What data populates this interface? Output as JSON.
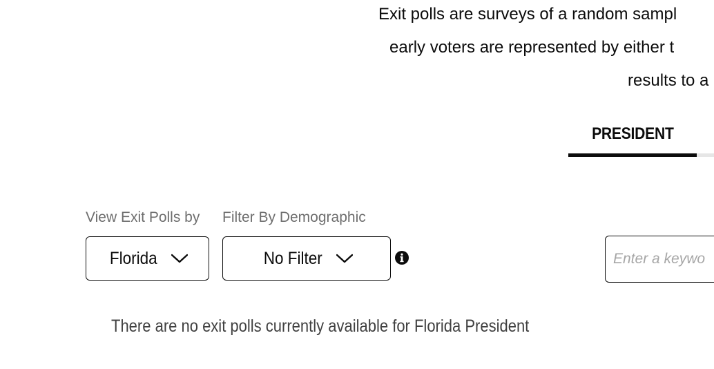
{
  "intro": {
    "line1": "Exit polls are surveys of a random sampl",
    "line2": "early voters are represented by either t",
    "line3": "results to a"
  },
  "tabs": [
    {
      "label": "PRESIDENT",
      "selected": true
    }
  ],
  "filters": {
    "view_by_label": "View Exit Polls by",
    "view_by_value": "Florida",
    "demographic_label": "Filter By Demographic",
    "demographic_value": "No Filter",
    "info_icon": "info-circle-icon",
    "chevron_icon": "chevron-down-icon"
  },
  "search": {
    "placeholder": "Enter a keywo",
    "value": ""
  },
  "message": {
    "empty": "There are no exit polls currently available for Florida President"
  },
  "colors": {
    "text": "#0c0c0c",
    "label": "#6e6e6e",
    "placeholder": "#a6a6a6",
    "message": "#404040",
    "tab_rail": "#e6e6e6"
  }
}
